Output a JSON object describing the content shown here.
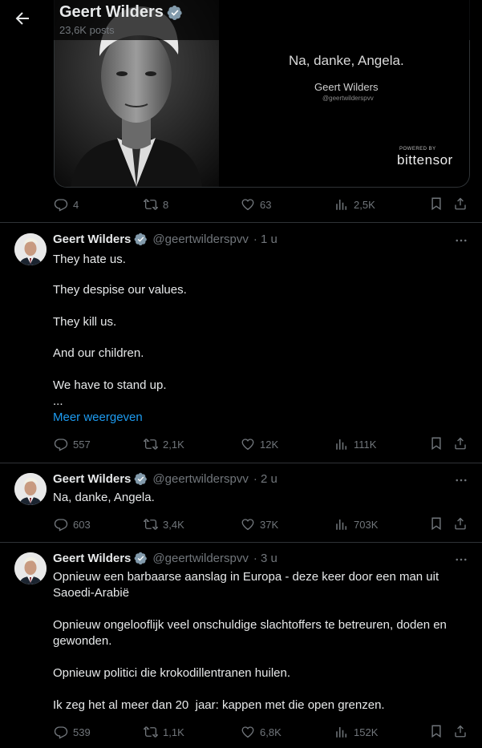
{
  "header": {
    "name": "Geert Wilders",
    "posts": "23,6K posts"
  },
  "media": {
    "quote": "Na, danke, Angela.",
    "signature_name": "Geert Wilders",
    "signature_handle": "@geertwilderspvv",
    "powered_by": "POWERED BY",
    "brand": "bittensor"
  },
  "top_actions": {
    "replies": "4",
    "reposts": "8",
    "likes": "63",
    "views": "2,5K"
  },
  "tweets": [
    {
      "name": "Geert Wilders",
      "handle": "@geertwilderspvv",
      "time": "· 1 u",
      "lines": [
        "They hate us.",
        "They despise our values.",
        "They kill us.",
        "And our children.",
        "We have to stand up.",
        "..."
      ],
      "show_more": "Meer weergeven",
      "replies": "557",
      "reposts": "2,1K",
      "likes": "12K",
      "views": "111K"
    },
    {
      "name": "Geert Wilders",
      "handle": "@geertwilderspvv",
      "time": "· 2 u",
      "lines": [
        "Na, danke, Angela."
      ],
      "replies": "603",
      "reposts": "3,4K",
      "likes": "37K",
      "views": "703K"
    },
    {
      "name": "Geert Wilders",
      "handle": "@geertwilderspvv",
      "time": "· 3 u",
      "lines": [
        "Opnieuw een barbaarse aanslag in Europa - deze keer door een man uit Saoedi-Arabië",
        "Opnieuw ongelooflijk veel onschuldige slachtoffers te betreuren, doden en gewonden.",
        "Opnieuw politici die krokodillentranen huilen.",
        "Ik zeg het al meer dan 20  jaar: kappen met die open grenzen."
      ],
      "replies": "539",
      "reposts": "1,1K",
      "likes": "6,8K",
      "views": "152K"
    }
  ],
  "colors": {
    "background": "#000000",
    "text": "#e7e9ea",
    "muted": "#71767b",
    "link": "#1d9bf0",
    "verified": "#829aab",
    "divider": "#2f3336"
  }
}
